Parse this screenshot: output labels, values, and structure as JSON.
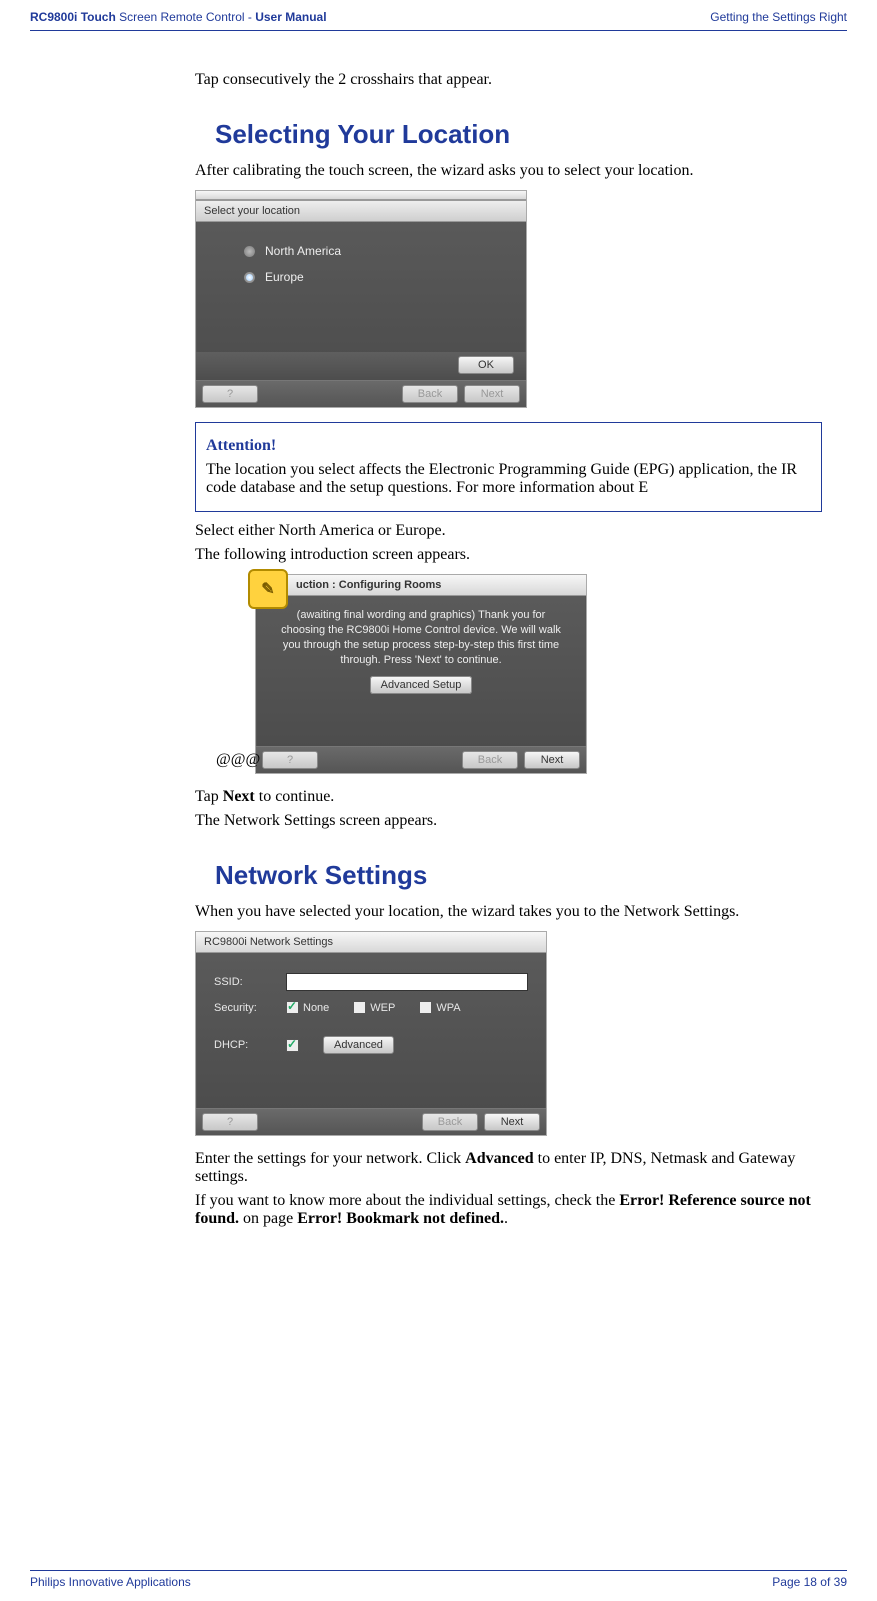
{
  "header": {
    "product_bold1": "RC9800i Touch",
    "product_mid": " Screen Remote Control - ",
    "product_bold2": "User Manual",
    "section": "Getting the Settings Right"
  },
  "footer": {
    "left": "Philips Innovative Applications",
    "right": "Page 18 of 39"
  },
  "body": {
    "crosshairs": "Tap consecutively the 2 crosshairs that appear.",
    "h_location": "Selecting Your Location",
    "loc_intro": "After calibrating the touch screen, the wizard asks you to select your location.",
    "attention_title": "Attention!",
    "attention_text": "The location you select affects the Electronic Programming Guide (EPG) application, the IR code database and the setup questions. For more information about E",
    "select_step": "Select either North America or Europe.",
    "select_result": "The following introduction screen appears.",
    "at_prefix": "@@@",
    "tap_next_pre": "Tap ",
    "tap_next_bold": "Next",
    "tap_next_post": " to continue.",
    "tap_next_result": "The Network Settings screen appears.",
    "h_network": "Network Settings",
    "net_intro": "When you have selected your location, the wizard takes you to the Network Settings.",
    "net_step_pre": "Enter the settings for your network. Click ",
    "net_step_bold": "Advanced",
    "net_step_post": " to enter IP, DNS, Netmask and Gateway settings.",
    "net_more_pre": "If you want to know more about the individual settings, check the ",
    "net_more_err1": "Error! Reference source not found.",
    "net_more_mid": " on page ",
    "net_more_err2": "Error! Bookmark not defined.",
    "net_more_end": "."
  },
  "ss1": {
    "title": " ",
    "label": "Select your location",
    "opt1": "North America",
    "opt2": "Europe",
    "ok": "OK",
    "help": "?",
    "back": "Back",
    "next": "Next"
  },
  "ss2": {
    "title": "uction : Configuring Rooms",
    "text": "(awaiting final wording and graphics) Thank you for choosing the RC9800i Home Control device. We will walk you through the setup process step-by-step this first time through. Press 'Next' to continue.",
    "adv": "Advanced Setup",
    "help": "?",
    "back": "Back",
    "next": "Next"
  },
  "ss3": {
    "title": "RC9800i Network Settings",
    "ssid_label": "SSID:",
    "sec_label": "Security:",
    "sec_none": "None",
    "sec_wep": "WEP",
    "sec_wpa": "WPA",
    "dhcp_label": "DHCP:",
    "adv": "Advanced",
    "help": "?",
    "back": "Back",
    "next": "Next"
  }
}
